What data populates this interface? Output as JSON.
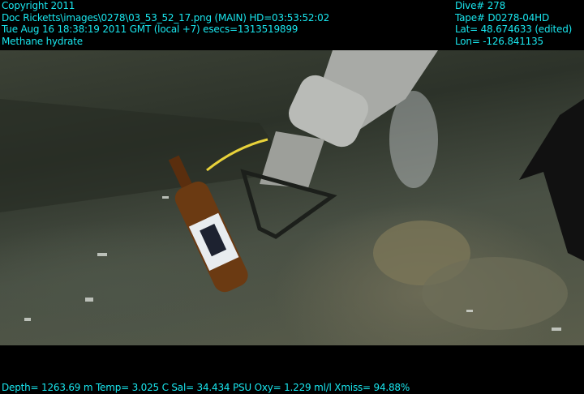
{
  "overlay_top_left": [
    "Copyright 2011",
    "Doc Ricketts\\images\\0278\\03_53_52_17.png (MAIN)  HD=03:53:52:02",
    "Tue Aug 16 18:38:19 2011 GMT (local +7)  esecs=1313519899",
    "Methane hydrate"
  ],
  "overlay_top_right": [
    "Dive# 278",
    "Tape# D0278-04HD",
    "Lat= 48.674633 (edited)",
    "Lon= -126.841135"
  ],
  "overlay_bottom": "Depth= 1263.69 m  Temp= 3.025 C  Sal= 34.434 PSU  Oxy= 1.229 ml/l  Xmiss= 94.88%",
  "colors": {
    "overlay_text": "#19e6ee",
    "background": "#000000"
  }
}
